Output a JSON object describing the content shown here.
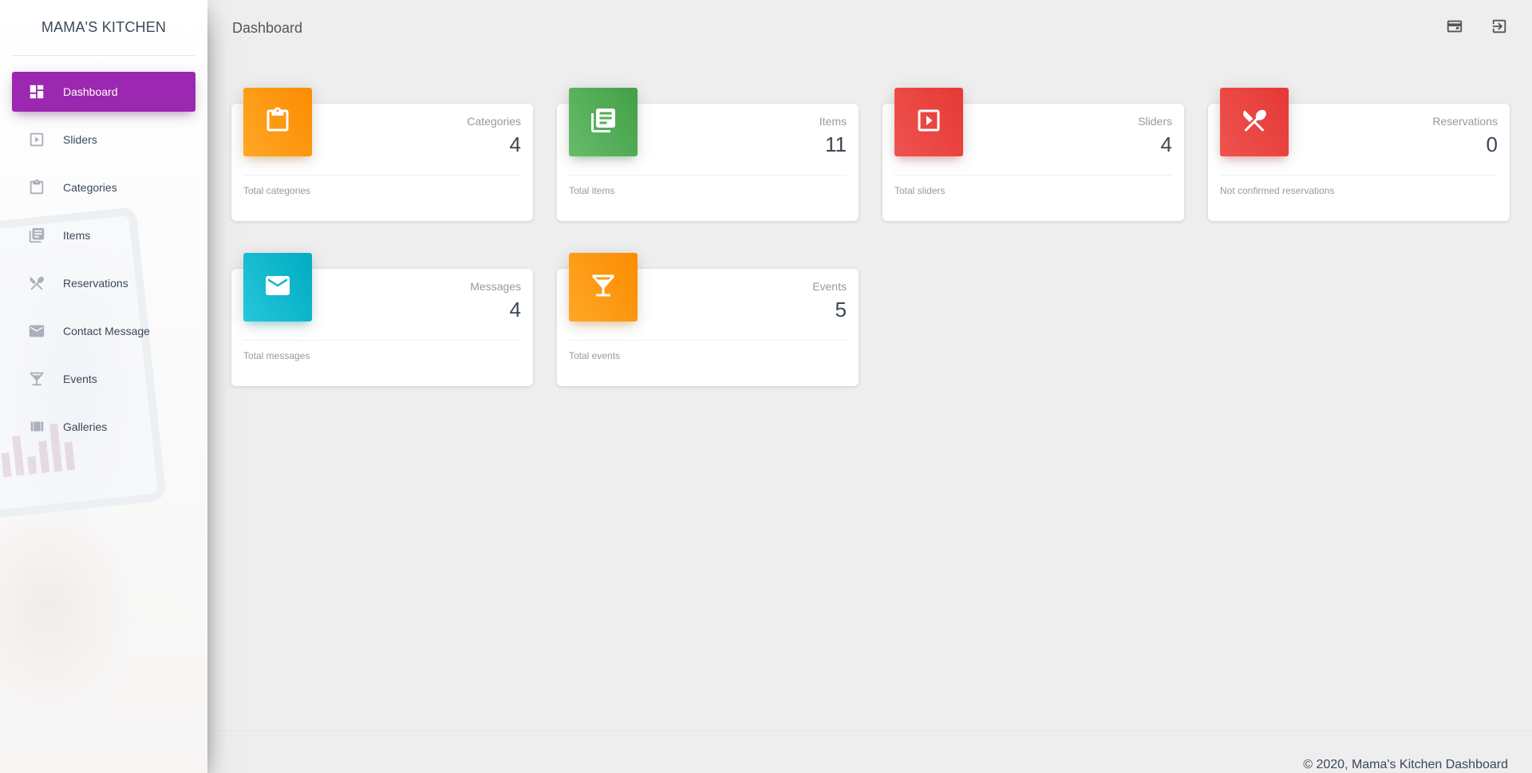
{
  "brand": "MAMA'S KITCHEN",
  "sidebar": {
    "items": [
      {
        "label": "Dashboard",
        "icon": "dashboard-icon",
        "active": true
      },
      {
        "label": "Sliders",
        "icon": "slideshow-icon"
      },
      {
        "label": "Categories",
        "icon": "clipboard-icon"
      },
      {
        "label": "Items",
        "icon": "library-books-icon"
      },
      {
        "label": "Reservations",
        "icon": "restaurant-icon"
      },
      {
        "label": "Contact Message",
        "icon": "mail-icon"
      },
      {
        "label": "Events",
        "icon": "cocktail-icon"
      },
      {
        "label": "Galleries",
        "icon": "view-array-icon"
      }
    ],
    "accent_color": "#9c27b0"
  },
  "header": {
    "title": "Dashboard",
    "actions": [
      "dashboard-view-icon",
      "logout-icon"
    ]
  },
  "cards": [
    {
      "category": "Categories",
      "value": "4",
      "footer": "Total categories",
      "icon": "clipboard-icon",
      "color": "#fb8c00"
    },
    {
      "category": "Items",
      "value": "11",
      "footer": "Total items",
      "icon": "library-books-icon",
      "color": "#43a047"
    },
    {
      "category": "Sliders",
      "value": "4",
      "footer": "Total sliders",
      "icon": "slideshow-icon",
      "color": "#e53935"
    },
    {
      "category": "Reservations",
      "value": "0",
      "footer": "Not confirmed reservations",
      "icon": "restaurant-icon",
      "color": "#e53935"
    },
    {
      "category": "Messages",
      "value": "4",
      "footer": "Total messages",
      "icon": "mail-icon",
      "color": "#00acc1"
    },
    {
      "category": "Events",
      "value": "5",
      "footer": "Total events",
      "icon": "cocktail-icon",
      "color": "#fb8c00"
    }
  ],
  "footer": {
    "copyright": "© 2020, Mama's Kitchen Dashboard"
  }
}
